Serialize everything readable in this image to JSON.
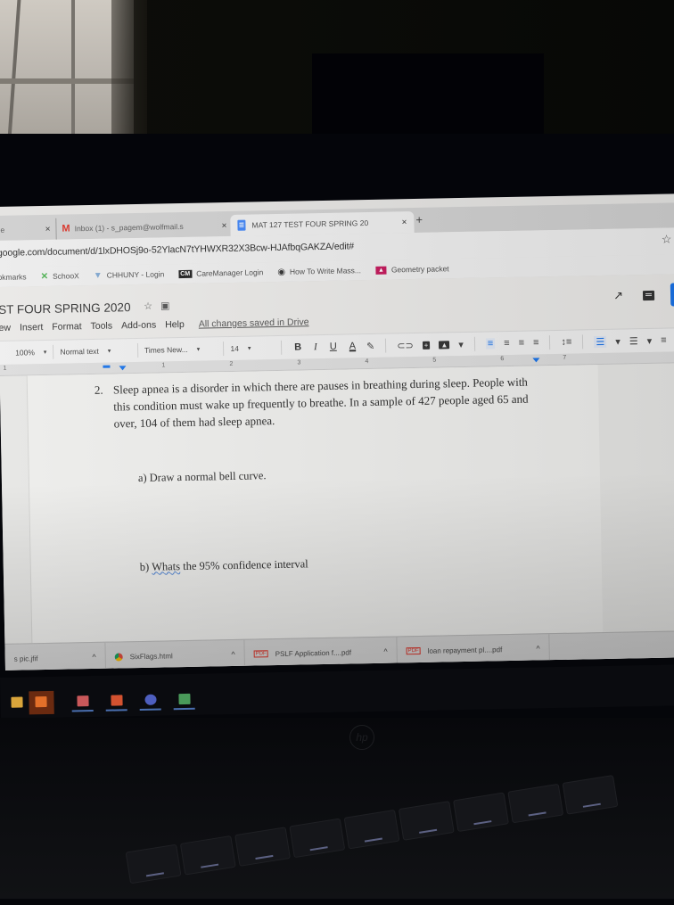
{
  "browser": {
    "tabs": [
      {
        "label": "le",
        "icon": "page-icon",
        "active": false
      },
      {
        "label": "Inbox (1) - s_pagem@wolfmail.s",
        "icon": "gmail-icon",
        "active": false
      },
      {
        "label": "MAT 127 TEST FOUR SPRING 20",
        "icon": "google-docs-icon",
        "active": true
      }
    ],
    "close_glyph": "×",
    "new_tab_glyph": "+",
    "url": "google.com/document/d/1lxDHOSj9o-52YlacN7tYHWXR32X3Bcw-HJAfbqGAKZA/edit#",
    "bookmark_star_glyph": "☆",
    "bookmarks": [
      {
        "label": "okmarks",
        "icon": ""
      },
      {
        "label": "SchooX",
        "icon": "✕"
      },
      {
        "label": "CHHUNY - Login",
        "icon": "▼"
      },
      {
        "label": "CareManager Login",
        "icon": "CM"
      },
      {
        "label": "How To Write Mass...",
        "icon": "◉"
      },
      {
        "label": "Geometry packet",
        "icon": "▲"
      }
    ]
  },
  "docs": {
    "title": "ST FOUR SPRING 2020",
    "star_glyph": "☆",
    "folder_glyph": "▣",
    "menu": [
      "ew",
      "Insert",
      "Format",
      "Tools",
      "Add-ons",
      "Help"
    ],
    "save_status": "All changes saved in Drive",
    "activity_glyph": "↗",
    "toolbar": {
      "zoom": "100%",
      "style": "Normal text",
      "font": "Times New...",
      "size": "14",
      "bold": "B",
      "italic": "I",
      "underline": "U",
      "text_color": "A",
      "highlight_glyph": "✎",
      "link_glyph": "⊂⊃",
      "comment_glyph": "+",
      "image_glyph": "▲",
      "align_glyph": "≡",
      "line_spacing_glyph": "↕≡",
      "numbered_list_glyph": "⅓",
      "bulleted_list_glyph": "☰",
      "caret_glyph": "▾"
    },
    "ruler_ticks": [
      "1",
      "1",
      "2",
      "3",
      "4",
      "5",
      "6",
      "7"
    ]
  },
  "document": {
    "question_number": "2.",
    "question_text": "Sleep apnea is a disorder in which there are pauses in breathing during sleep. People with this condition must wake up frequently to breathe. In a sample of 427 people aged 65 and over, 104 of them had sleep apnea.",
    "part_a": {
      "label": "a)",
      "text": "Draw a normal bell curve."
    },
    "part_b": {
      "label": "b)",
      "misspelled": "Whats",
      "text": " the 95% confidence interval"
    }
  },
  "downloads": [
    {
      "name": "s pic.jfif",
      "icon": "file-icon"
    },
    {
      "name": "SixFlags.html",
      "icon": "chrome-icon"
    },
    {
      "name": "PSLF Application f....pdf",
      "icon": "pdf-icon"
    },
    {
      "name": "loan repayment pl....pdf",
      "icon": "pdf-icon"
    }
  ],
  "download_chevron": "^",
  "taskbar": {
    "apps": [
      "File Explorer",
      "Outlook",
      "Acrobat",
      "PowerPoint",
      "Teams",
      "Excel"
    ],
    "outlook_glyph": "O",
    "ppt_glyph": "P",
    "excel_glyph": "X"
  },
  "laptop": {
    "logo": "hp"
  },
  "colors": {
    "accent": "#1a73e8",
    "gmail": "#d93025",
    "docs": "#4285f4"
  }
}
